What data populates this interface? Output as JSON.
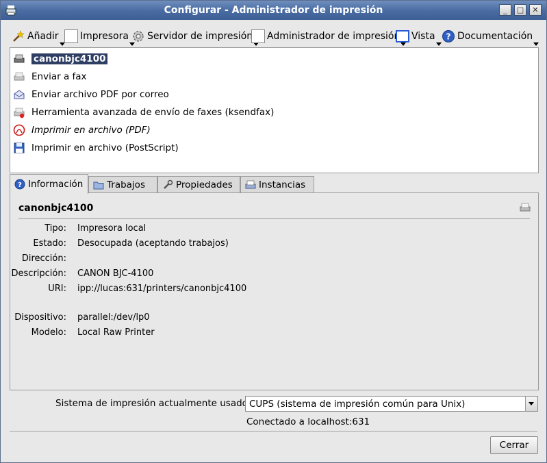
{
  "window": {
    "title": "Configurar - Administrador de impresión"
  },
  "toolbar": {
    "add": "Añadir",
    "printer": "Impresora",
    "server": "Servidor de impresión",
    "manager": "Administrador de impresión",
    "view": "Vista",
    "docs": "Documentación"
  },
  "printers": [
    {
      "name": "canonbjc4100",
      "icon": "printer-icon"
    },
    {
      "name": "Enviar a fax",
      "icon": "fax-icon"
    },
    {
      "name": "Enviar archivo PDF por correo",
      "icon": "mail-icon"
    },
    {
      "name": "Herramienta avanzada de envío de faxes (ksendfax)",
      "icon": "fax-icon"
    },
    {
      "name": "Imprimir en archivo (PDF)",
      "icon": "pdf-icon"
    },
    {
      "name": "Imprimir en archivo (PostScript)",
      "icon": "save-icon"
    }
  ],
  "tabs": {
    "info": "Información",
    "jobs": "Trabajos",
    "props": "Propiedades",
    "instances": "Instancias"
  },
  "info": {
    "title": "canonbjc4100",
    "fields": [
      {
        "k": "Tipo:",
        "v": "Impresora local"
      },
      {
        "k": "Estado:",
        "v": "Desocupada (aceptando trabajos)"
      },
      {
        "k": "Dirección:",
        "v": ""
      },
      {
        "k": "Descripción:",
        "v": "CANON BJC-4100"
      },
      {
        "k": "URI:",
        "v": "ipp://lucas:631/printers/canonbjc4100"
      },
      {
        "k": "Dispositivo:",
        "v": "parallel:/dev/lp0"
      },
      {
        "k": "Modelo:",
        "v": "Local Raw Printer"
      }
    ]
  },
  "system": {
    "label": "Sistema de impresión actualmente usado:",
    "value": "CUPS (sistema de impresión común para Unix)",
    "connected": "Conectado a localhost:631"
  },
  "close_label": "Cerrar"
}
